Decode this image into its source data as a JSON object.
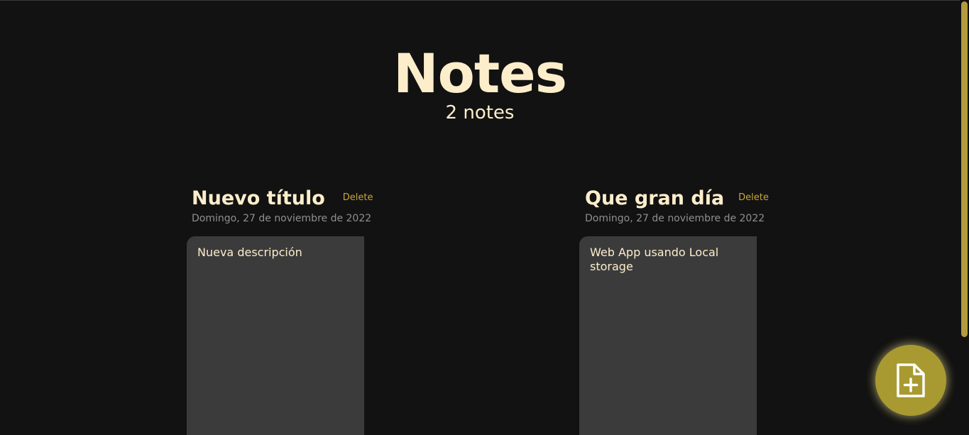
{
  "header": {
    "title": "Notes",
    "count_label": "2 notes"
  },
  "notes": [
    {
      "title": "Nuevo título",
      "delete_label": "Delete",
      "date": "Domingo, 27 de noviembre de 2022",
      "description": "Nueva descripción"
    },
    {
      "title": "Que gran día",
      "delete_label": "Delete",
      "date": "Domingo, 27 de noviembre de 2022",
      "description": "Web App usando Local storage"
    }
  ],
  "fab": {
    "icon": "file-plus-icon"
  },
  "colors": {
    "background": "#121212",
    "text": "#fdeecb",
    "accent": "#c9a63d",
    "card": "#3b3b3b",
    "fab": "#a89a31"
  }
}
